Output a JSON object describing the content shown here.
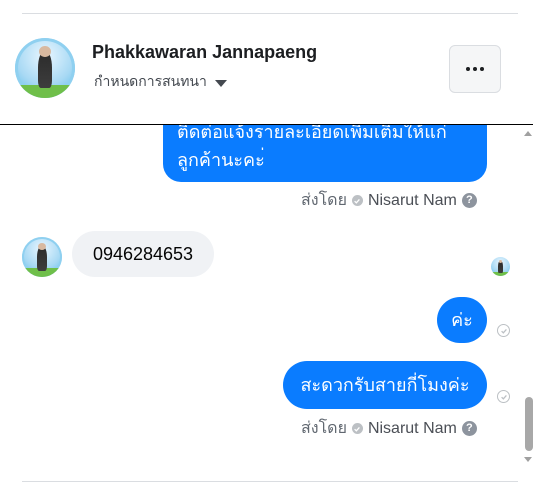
{
  "header": {
    "name": "Phakkawaran Jannapaeng",
    "subtitle": "กำหนดการสนทนา",
    "more_icon": "more-horizontal-icon"
  },
  "messages": {
    "out1_line1": "ติดต่อแจ้งรายละเอียดเพิ่มเติมให้แก่",
    "out1_line2": "ลูกค้านะคะ่",
    "sent_by_1_prefix": "ส่งโดย",
    "sent_by_1_name": "Nisarut Nam",
    "in1": "0946284653",
    "out2": "ค่ะ",
    "out3": "สะดวกรับสายกี่โมงค่ะ",
    "sent_by_2_prefix": "ส่งโดย",
    "sent_by_2_name": "Nisarut Nam"
  },
  "colors": {
    "outgoing_bubble": "#0a7cff",
    "incoming_bubble": "#f0f2f5",
    "text_secondary": "#606770"
  }
}
